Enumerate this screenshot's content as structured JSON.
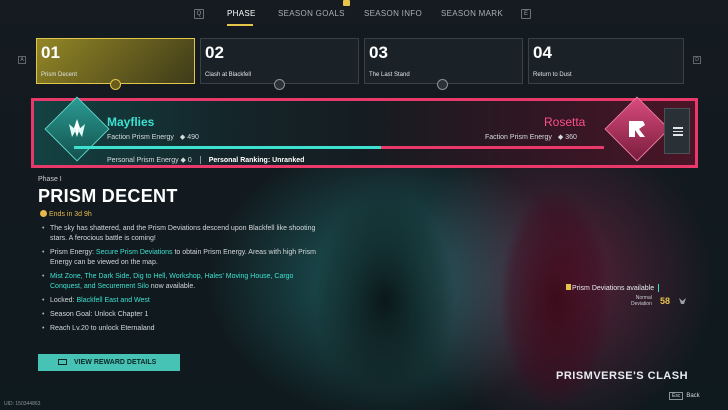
{
  "nav": {
    "key_left": "Q",
    "key_right": "E",
    "tabs": [
      "PHASE",
      "SEASON GOALS",
      "SEASON INFO",
      "SEASON MARK"
    ],
    "active_tab": "PHASE",
    "accent": "#e8c34a"
  },
  "phases": {
    "key_left": "A",
    "key_right": "D",
    "items": [
      {
        "num": "01",
        "name": "Prism Decent",
        "active": true
      },
      {
        "num": "02",
        "name": "Clash at Blackfell",
        "active": false
      },
      {
        "num": "03",
        "name": "The Last Stand",
        "active": false
      },
      {
        "num": "04",
        "name": "Return to Dust",
        "active": false
      }
    ]
  },
  "factions": {
    "left": {
      "name": "Mayflies",
      "energy_label": "Faction Prism Energy",
      "energy": "490",
      "color": "#3ee0cf"
    },
    "right": {
      "name": "Rosetta",
      "energy_label": "Faction Prism Energy",
      "energy": "360",
      "color": "#ff4f86"
    },
    "left_share": 0.58,
    "personal_label": "Personal Prism Energy",
    "personal_value": "0",
    "ranking": "Personal Ranking: Unranked",
    "border_color": "#e9386a"
  },
  "phase_detail": {
    "label": "Phase I",
    "title": "PRISM DECENT",
    "ends_in": "Ends in 3d 9h",
    "bullets": [
      {
        "parts": [
          {
            "t": "The sky has shattered, and the Prism Deviations descend upon Blackfell like shooting stars. A ferocious battle is coming!",
            "hl": false
          }
        ]
      },
      {
        "parts": [
          {
            "t": "Prism Energy: ",
            "hl": false
          },
          {
            "t": "Secure Prism Deviations",
            "hl": true
          },
          {
            "t": " to obtain Prism Energy. Areas with high Prism Energy can be viewed on the map.",
            "hl": false
          }
        ]
      },
      {
        "parts": [
          {
            "t": "Mist Zone, The Dark Side, Dig to Hell, Workshop, Hales' Moving House, Cargo Conquest, and Securement Silo",
            "hl": true
          },
          {
            "t": " now available.",
            "hl": false
          }
        ]
      },
      {
        "parts": [
          {
            "t": "Locked: ",
            "hl": false
          },
          {
            "t": "Blackfell East and West",
            "hl": true
          }
        ]
      },
      {
        "parts": [
          {
            "t": "Season Goal: Unlock Chapter 1",
            "hl": false
          }
        ]
      },
      {
        "parts": [
          {
            "t": "Reach Lv.20 to unlock Eternaland",
            "hl": false
          }
        ]
      }
    ],
    "reward_button": "VIEW REWARD DETAILS"
  },
  "deviation": {
    "available": "Prism Deviations available",
    "normal_label_1": "Normal",
    "normal_label_2": "Deviation",
    "normal_value": "58"
  },
  "footer": {
    "uid": "UID: 150344863",
    "clash_title": "PRISMVERSE'S CLASH",
    "esc_key": "Esc",
    "back": "Back"
  }
}
